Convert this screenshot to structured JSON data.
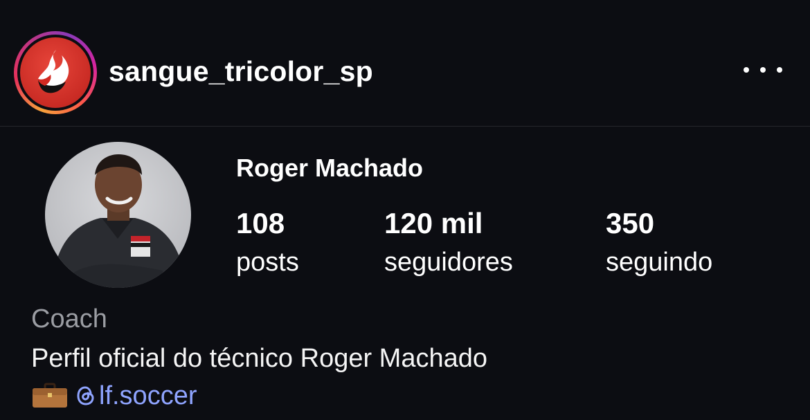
{
  "header": {
    "username": "sangue_tricolor_sp",
    "more_icon": "more-horizontal-icon"
  },
  "profile": {
    "display_name": "Roger Machado",
    "stats": [
      {
        "value": "108",
        "label": "posts"
      },
      {
        "value": "120 mil",
        "label": "seguidores"
      },
      {
        "value": "350",
        "label": "seguindo"
      }
    ],
    "category": "Coach",
    "bio": "Perfil oficial do técnico Roger Machado",
    "link_emoji": "briefcase-icon",
    "threads_handle": "lf.soccer"
  },
  "colors": {
    "background": "#0c0d12",
    "link": "#8fa4ff",
    "muted": "#9b9da3"
  }
}
